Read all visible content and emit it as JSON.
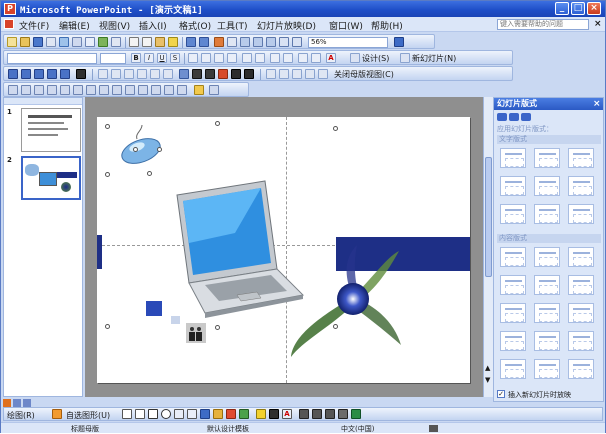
{
  "window": {
    "title": "Microsoft PowerPoint - [演示文稿1]",
    "app_icon": "powerpoint-icon",
    "controls": [
      "minimize-icon",
      "maximize-icon",
      "close-icon"
    ]
  },
  "menubar": {
    "items": [
      "文件(F)",
      "编辑(E)",
      "视图(V)",
      "插入(I)",
      "格式(O)",
      "工具(T)",
      "幻灯片放映(D)",
      "窗口(W)",
      "帮助(H)"
    ],
    "help_placeholder": "键入需要帮助的问题",
    "close": "×"
  },
  "toolbars": {
    "zoom": "56%",
    "design_button": "设计(S)",
    "new_slide_button": "新幻灯片(N)",
    "close_master_view": "关闭母版视图(C)"
  },
  "outline": {
    "slide_numbers": [
      "1",
      "2"
    ],
    "selected": 2
  },
  "task_pane": {
    "title": "幻灯片版式",
    "close": "×",
    "section_label": "应用幻灯片版式：",
    "group_text": "文字版式",
    "group_content": "内容版式",
    "checkbox_label": "插入新幻灯片时放映",
    "checkbox_checked": true
  },
  "drawing_toolbar": {
    "draw_menu": "绘图(R)",
    "autoshapes_menu": "自选图形(U)"
  },
  "status": {
    "slide_info": "标题母版",
    "design": "默认设计模板",
    "language": "中文(中国)"
  },
  "colors": {
    "title_bar": "#1f4fc8",
    "office_chrome": "#dbe6f8",
    "slide_bar": "#1e2f86",
    "edit_area_bg": "#8f8f8f"
  }
}
